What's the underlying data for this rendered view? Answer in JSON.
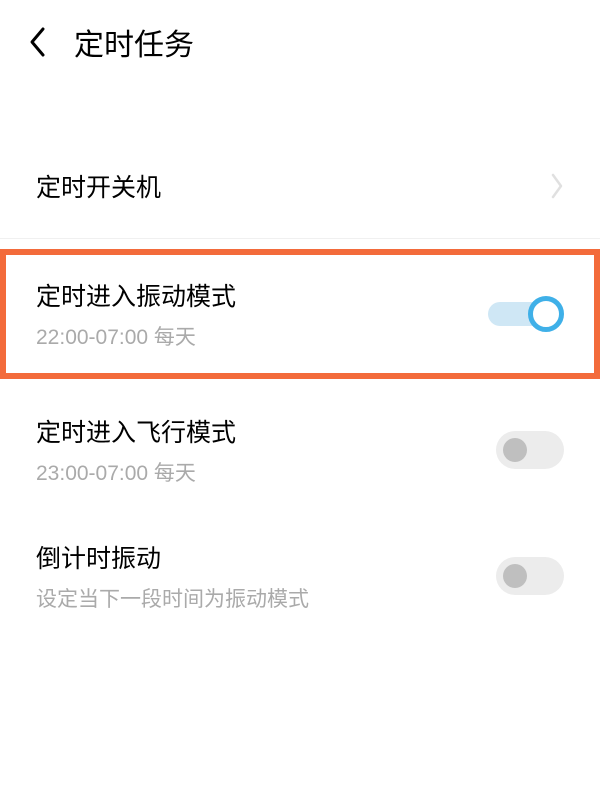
{
  "header": {
    "title": "定时任务"
  },
  "rows": {
    "powerSchedule": {
      "title": "定时开关机"
    },
    "vibrateSchedule": {
      "title": "定时进入振动模式",
      "subtitle": "22:00-07:00 每天"
    },
    "airplaneSchedule": {
      "title": "定时进入飞行模式",
      "subtitle": "23:00-07:00 每天"
    },
    "countdownVibrate": {
      "title": "倒计时振动",
      "subtitle": "设定当下一段时间为振动模式"
    }
  }
}
